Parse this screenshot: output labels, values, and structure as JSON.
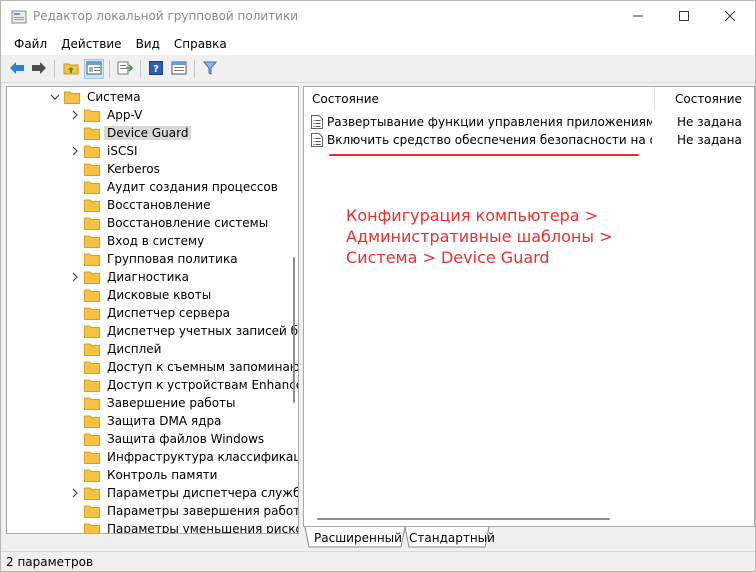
{
  "window": {
    "title": "Редактор локальной групповой политики"
  },
  "menu": {
    "items": [
      "Файл",
      "Действие",
      "Вид",
      "Справка"
    ]
  },
  "toolbar": {
    "icons": [
      "back-arrow-icon",
      "forward-arrow-icon",
      "up-folder-icon",
      "show-hide-tree-icon",
      "export-list-icon",
      "help-icon",
      "properties-icon",
      "filter-icon"
    ]
  },
  "tree": {
    "parent": "Система",
    "items": [
      {
        "label": "App-V",
        "expandable": true,
        "selected": false
      },
      {
        "label": "Device Guard",
        "expandable": false,
        "selected": true
      },
      {
        "label": "iSCSI",
        "expandable": true,
        "selected": false
      },
      {
        "label": "Kerberos",
        "expandable": false,
        "selected": false
      },
      {
        "label": "Аудит создания процессов",
        "expandable": false,
        "selected": false
      },
      {
        "label": "Восстановление",
        "expandable": false,
        "selected": false
      },
      {
        "label": "Восстановление системы",
        "expandable": false,
        "selected": false
      },
      {
        "label": "Вход в систему",
        "expandable": false,
        "selected": false
      },
      {
        "label": "Групповая политика",
        "expandable": false,
        "selected": false
      },
      {
        "label": "Диагностика",
        "expandable": true,
        "selected": false
      },
      {
        "label": "Дисковые квоты",
        "expandable": false,
        "selected": false
      },
      {
        "label": "Диспетчер сервера",
        "expandable": false,
        "selected": false
      },
      {
        "label": "Диспетчер учетных записей безопасности",
        "expandable": false,
        "selected": false
      },
      {
        "label": "Дисплей",
        "expandable": false,
        "selected": false
      },
      {
        "label": "Доступ к съемным запоминающим устройствам",
        "expandable": false,
        "selected": false
      },
      {
        "label": "Доступ к устройствам Enhanced Storage",
        "expandable": false,
        "selected": false
      },
      {
        "label": "Завершение работы",
        "expandable": false,
        "selected": false
      },
      {
        "label": "Защита DMA ядра",
        "expandable": false,
        "selected": false
      },
      {
        "label": "Защита файлов Windows",
        "expandable": false,
        "selected": false
      },
      {
        "label": "Инфраструктура классификации файлов",
        "expandable": false,
        "selected": false
      },
      {
        "label": "Контроль памяти",
        "expandable": false,
        "selected": false
      },
      {
        "label": "Параметры диспетчера служб",
        "expandable": true,
        "selected": false
      },
      {
        "label": "Параметры завершения работы",
        "expandable": false,
        "selected": false
      },
      {
        "label": "Параметры уменьшения рисков",
        "expandable": false,
        "selected": false
      }
    ]
  },
  "list": {
    "columns": [
      "Состояние",
      "Состояние"
    ],
    "rows": [
      {
        "name": "Развертывание функции управления приложениями в Защитнике Windows",
        "state": "Не задана"
      },
      {
        "name": "Включить средство обеспечения безопасности на основе виртуализации",
        "state": "Не задана"
      }
    ]
  },
  "annotation": {
    "lines": [
      "Конфигурация компьютера >",
      "Административные шаблоны >",
      "Система > Device Guard"
    ],
    "color": "#e8302f"
  },
  "tabs": [
    "Расширенный",
    "Стандартный"
  ],
  "status": {
    "text": "2 параметров"
  },
  "colors": {
    "folder": "#f5c242",
    "accent_annotation": "#e8302f",
    "selection": "#d9d9d9"
  }
}
